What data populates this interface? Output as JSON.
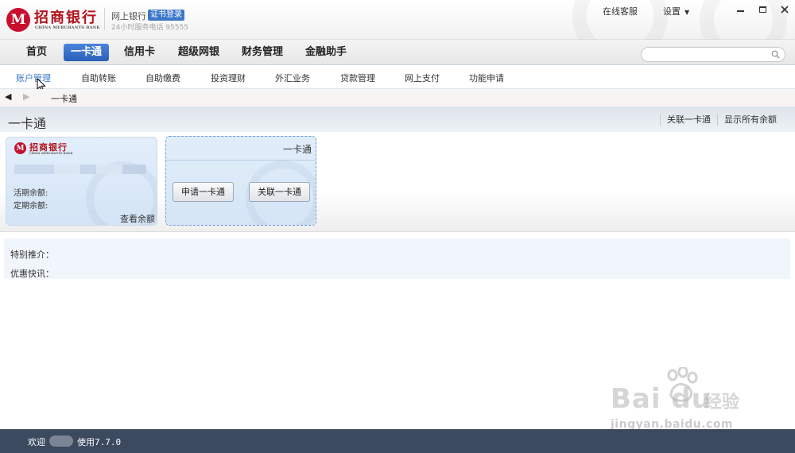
{
  "titlebar": {
    "logo_mark": "M",
    "logo_cn": "招商银行",
    "logo_en": "CHINA MERCHANTS BANK",
    "app_name": "网上银行",
    "cert_badge": "证书登录",
    "service_hotline": "24小时服务电话 95555",
    "online_service": "在线客服",
    "settings_label": "设置",
    "settings_caret": "▼"
  },
  "main_nav": {
    "tabs": [
      {
        "label": "首页"
      },
      {
        "label": "一卡通",
        "active": true
      },
      {
        "label": "信用卡"
      },
      {
        "label": "超级网银"
      },
      {
        "label": "财务管理"
      },
      {
        "label": "金融助手"
      }
    ],
    "search": {
      "value": "",
      "placeholder": ""
    }
  },
  "sub_nav": {
    "items": [
      {
        "label": "账户管理",
        "active": true
      },
      {
        "label": "自助转账"
      },
      {
        "label": "自助缴费"
      },
      {
        "label": "投资理财"
      },
      {
        "label": "外汇业务"
      },
      {
        "label": "贷款管理"
      },
      {
        "label": "网上支付"
      },
      {
        "label": "功能申请"
      }
    ]
  },
  "breadcrumb": {
    "back": "◀",
    "forward": "▶",
    "current": "一卡通"
  },
  "page": {
    "title": "一卡通",
    "link_associate": "关联一卡通",
    "link_show_balances": "显示所有余额"
  },
  "card": {
    "logo_cn": "招商银行",
    "logo_en": "CHINA MERCHANTS BANK",
    "current_balance_label": "活期余额:",
    "fixed_balance_label": "定期余额:",
    "check_balance": "查看余额"
  },
  "add_card_panel": {
    "title": "一卡通",
    "apply_button": "申请一卡通",
    "link_button": "关联一卡通"
  },
  "promo": {
    "special": "特别推介：",
    "news": "优惠快讯："
  },
  "watermark": {
    "logo": "Bai du",
    "text": "经验",
    "url": "jingyan.baidu.com"
  },
  "statusbar": {
    "welcome": "欢迎",
    "usage": "使用",
    "version": "7.7.0"
  },
  "colors": {
    "brand_red": "#c8102e",
    "accent_blue": "#2a5fb8",
    "status_bar": "#3c4a60"
  }
}
